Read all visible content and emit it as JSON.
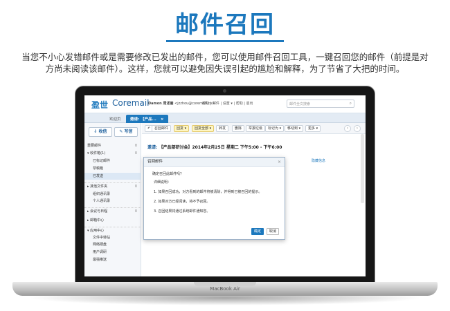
{
  "heading": "邮件召回",
  "intro_line1": "当您不小心发错邮件或是需要修改已发出的邮件，您可以使用邮件召回工具，一键召回您的邮件（前提是对",
  "intro_line2": "方尚未阅读该邮件）。这样，您就可以避免因失误引起的尴尬和解释，为了节省了大把的时间。",
  "laptop_label": "MacBook Air",
  "app": {
    "logo_a": "盈世",
    "logo_b": "Coremail",
    "user_name": "Damon 周述嵩",
    "user_email": "<jzzhou@coremail.cn>",
    "top_links": "帮助 | 邮件 | 设置 ▾ | 帮助 | 退出",
    "search_placeholder": "邮件全文搜索",
    "tabs": [
      "欢迎页",
      "邀请: 【产品...",
      "×"
    ],
    "sidebar_buttons": [
      "收信",
      "写信"
    ],
    "folders": [
      {
        "label": "重要邮件",
        "count": "0"
      },
      {
        "label": "▾ 收件箱(1)",
        "count": "0"
      },
      {
        "label": "已标记邮件",
        "count": ""
      },
      {
        "label": "草稿箱",
        "count": ""
      },
      {
        "label": "已发送",
        "count": ""
      },
      {
        "label": "▸ 其他文件夹",
        "count": "0"
      },
      {
        "label": "组织通讯录",
        "count": ""
      },
      {
        "label": "个人通讯录",
        "count": ""
      },
      {
        "label": "▸ 会议与日程",
        "count": "0"
      },
      {
        "label": "▸ 邮箱中心",
        "count": ""
      },
      {
        "label": "▾ 应用中心",
        "count": ""
      },
      {
        "label": "文件中转站",
        "count": ""
      },
      {
        "label": "网络硬盘",
        "count": ""
      },
      {
        "label": "用户调研",
        "count": ""
      },
      {
        "label": "最强推送",
        "count": ""
      }
    ],
    "toolbar": [
      "↶",
      "召回邮件",
      "回复 ▾",
      "回复全部 ▾",
      "转发",
      "删除",
      "举报垃圾",
      "标记为 ▾",
      "移动到 ▾",
      "更多 ▾"
    ],
    "subject_prefix": "邀请:",
    "subject_text": "【产品部研讨会】2014年2月25日 星期二 下午5:00 - 下午6:00",
    "side_link": "隐藏信息",
    "dialog": {
      "title": "召回邮件",
      "close": "×",
      "question": "确定召回此邮件吗？",
      "details_title": "详细说明：",
      "line1": "1. 如果召回成功，对方看到的邮件将被清除，并得到已被召回的提示。",
      "line2": "2. 如果对方已经阅读，将不予召回。",
      "line3": "3. 召回结果将通过系统邮件通知您。",
      "ok": "确定",
      "cancel": "取消"
    }
  }
}
